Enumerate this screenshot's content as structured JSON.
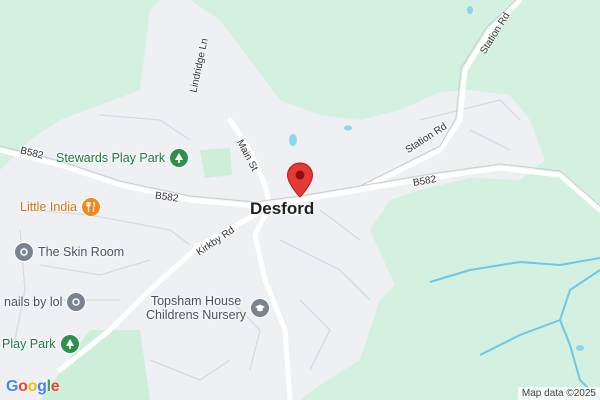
{
  "map": {
    "town": "Desford",
    "roads": {
      "b582_west": "B582",
      "b582_mid": "B582",
      "b582_east": "B582",
      "main_st": "Main St",
      "lindridge_ln": "Lindridge Ln",
      "station_rd_north": "Station Rd",
      "station_rd_south": "Station Rd",
      "kirkby_rd": "Kirkby Rd"
    },
    "pois": {
      "stewards": "Stewards Play Park",
      "little_india": "Little India",
      "skin_room": "The Skin Room",
      "nails": "nails by lol",
      "nursery_line1": "Topsham House",
      "nursery_line2": "Childrens Nursery",
      "play_park": "Play Park"
    },
    "logo": [
      "G",
      "o",
      "o",
      "g",
      "l",
      "e"
    ],
    "attribution": "Map data ©2025"
  },
  "colors": {
    "green_background": "#d4f0e0",
    "urban_area": "#eef0f3",
    "water": "#6ec6e8",
    "marker": "#e53935",
    "park": "#2f8f50",
    "food": "#f08a1c",
    "poi_grey": "#7b8390"
  },
  "icons": {
    "park": "tree-icon",
    "food": "fork-knife-icon",
    "shop": "shop-icon",
    "education": "graduation-cap-icon",
    "marker": "map-pin-icon"
  }
}
